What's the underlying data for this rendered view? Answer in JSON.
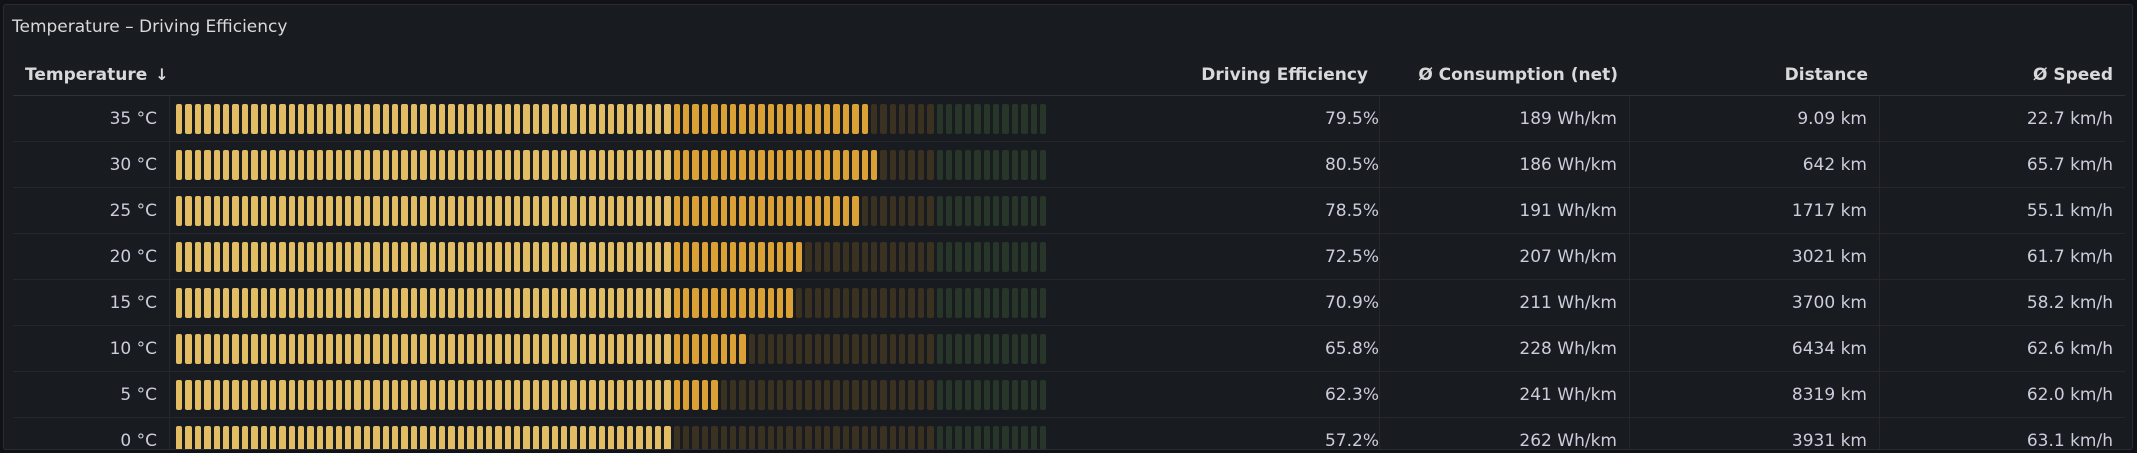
{
  "panel": {
    "title": "Temperature – Driving Efficiency"
  },
  "columns": {
    "temperature": "Temperature",
    "efficiency": "Driving Efficiency",
    "consumption": "Ø Consumption (net)",
    "distance": "Distance",
    "speed": "Ø Speed",
    "sort_icon": "arrow-down-icon"
  },
  "colors": {
    "filled_light": "#e3bd63",
    "filled_orange": "#dba134",
    "unfilled_orange": "#3a3120",
    "unfilled_green": "#273629"
  },
  "gauge": {
    "segments": 93,
    "orange_threshold": 0.57,
    "green_threshold": 0.87
  },
  "rows": [
    {
      "temperature": "35 °C",
      "efficiency": "79.5%",
      "efficiency_value": 0.795,
      "consumption": "189 Wh/km",
      "distance": "9.09 km",
      "speed": "22.7 km/h"
    },
    {
      "temperature": "30 °C",
      "efficiency": "80.5%",
      "efficiency_value": 0.805,
      "consumption": "186 Wh/km",
      "distance": "642 km",
      "speed": "65.7 km/h"
    },
    {
      "temperature": "25 °C",
      "efficiency": "78.5%",
      "efficiency_value": 0.785,
      "consumption": "191 Wh/km",
      "distance": "1717 km",
      "speed": "55.1 km/h"
    },
    {
      "temperature": "20 °C",
      "efficiency": "72.5%",
      "efficiency_value": 0.725,
      "consumption": "207 Wh/km",
      "distance": "3021 km",
      "speed": "61.7 km/h"
    },
    {
      "temperature": "15 °C",
      "efficiency": "70.9%",
      "efficiency_value": 0.709,
      "consumption": "211 Wh/km",
      "distance": "3700 km",
      "speed": "58.2 km/h"
    },
    {
      "temperature": "10 °C",
      "efficiency": "65.8%",
      "efficiency_value": 0.658,
      "consumption": "228 Wh/km",
      "distance": "6434 km",
      "speed": "62.6 km/h"
    },
    {
      "temperature": "5 °C",
      "efficiency": "62.3%",
      "efficiency_value": 0.623,
      "consumption": "241 Wh/km",
      "distance": "8319 km",
      "speed": "62.0 km/h"
    },
    {
      "temperature": "0 °C",
      "efficiency": "57.2%",
      "efficiency_value": 0.572,
      "consumption": "262 Wh/km",
      "distance": "3931 km",
      "speed": "63.1 km/h"
    }
  ]
}
